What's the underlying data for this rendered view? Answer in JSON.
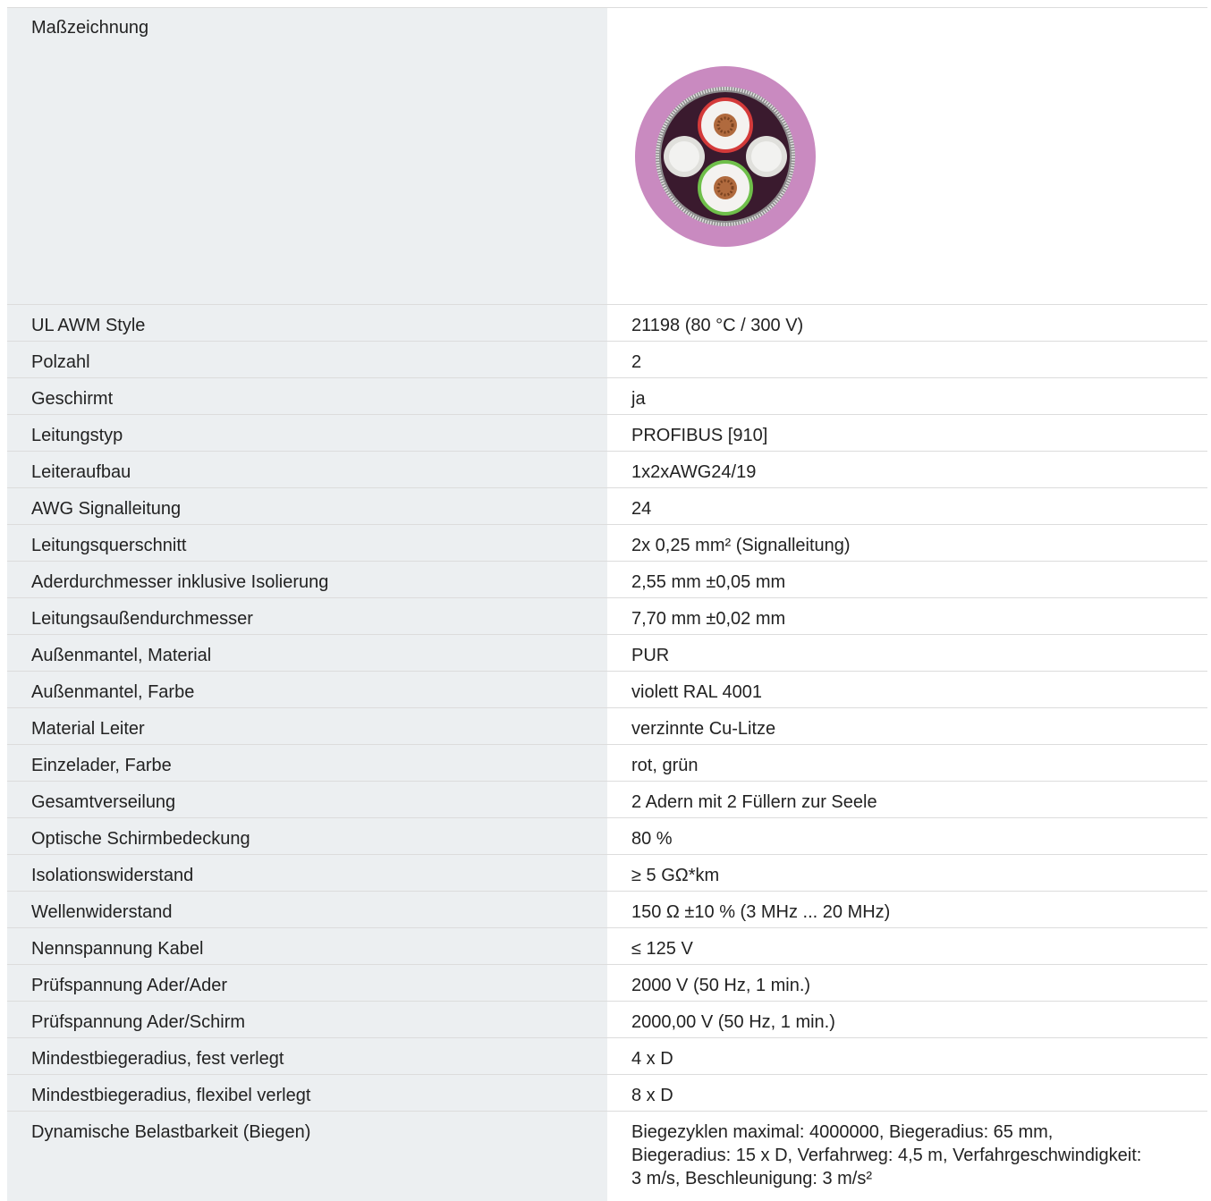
{
  "drawing": {
    "label": "Maßzeichnung",
    "colors": {
      "jacket": "#c98ac0",
      "core": "#3a1a2e",
      "shield": "#8c8c8c",
      "conductor": "#b06a3e",
      "insulation_a": "#d43a3a",
      "insulation_b": "#6fbf4a",
      "filler": "#f2f2f0"
    }
  },
  "rows": [
    {
      "label": "UL AWM Style",
      "value": "21198 (80 °C / 300 V)"
    },
    {
      "label": "Polzahl",
      "value": "2"
    },
    {
      "label": "Geschirmt",
      "value": "ja"
    },
    {
      "label": "Leitungstyp",
      "value": "PROFIBUS [910]"
    },
    {
      "label": "Leiteraufbau",
      "value": "1x2xAWG24/19"
    },
    {
      "label": "AWG Signalleitung",
      "value": "24"
    },
    {
      "label": "Leitungsquerschnitt",
      "value": "2x 0,25 mm² (Signalleitung)"
    },
    {
      "label": "Aderdurchmesser inklusive Isolierung",
      "value": "2,55 mm ±0,05 mm"
    },
    {
      "label": "Leitungsaußendurchmesser",
      "value": "7,70 mm ±0,02 mm"
    },
    {
      "label": "Außenmantel, Material",
      "value": "PUR"
    },
    {
      "label": "Außenmantel, Farbe",
      "value": "violett RAL 4001"
    },
    {
      "label": "Material Leiter",
      "value": "verzinnte Cu-Litze"
    },
    {
      "label": "Einzelader, Farbe",
      "value": "rot, grün"
    },
    {
      "label": "Gesamtverseilung",
      "value": "2 Adern mit 2 Füllern zur Seele"
    },
    {
      "label": "Optische Schirmbedeckung",
      "value": "80 %"
    },
    {
      "label": "Isolationswiderstand",
      "value": "≥ 5 GΩ*km"
    },
    {
      "label": "Wellenwiderstand",
      "value": "150 Ω ±10 % (3 MHz ... 20 MHz)"
    },
    {
      "label": "Nennspannung Kabel",
      "value": "≤ 125 V"
    },
    {
      "label": "Prüfspannung Ader/Ader",
      "value": "2000 V (50 Hz, 1 min.)"
    },
    {
      "label": "Prüfspannung Ader/Schirm",
      "value": "2000,00 V (50 Hz, 1 min.)"
    },
    {
      "label": "Mindestbiegeradius, fest verlegt",
      "value": "4 x D"
    },
    {
      "label": "Mindestbiegeradius, flexibel verlegt",
      "value": "8 x D"
    }
  ],
  "dynamic": {
    "label": "Dynamische Belastbarkeit (Biegen)",
    "lines": [
      "Biegezyklen maximal: 4000000, Biegeradius: 65 mm,",
      "Biegeradius: 15 x D, Verfahrweg: 4,5 m, Verfahrgeschwindigkeit:",
      "3 m/s, Beschleunigung: 3 m/s²"
    ]
  }
}
